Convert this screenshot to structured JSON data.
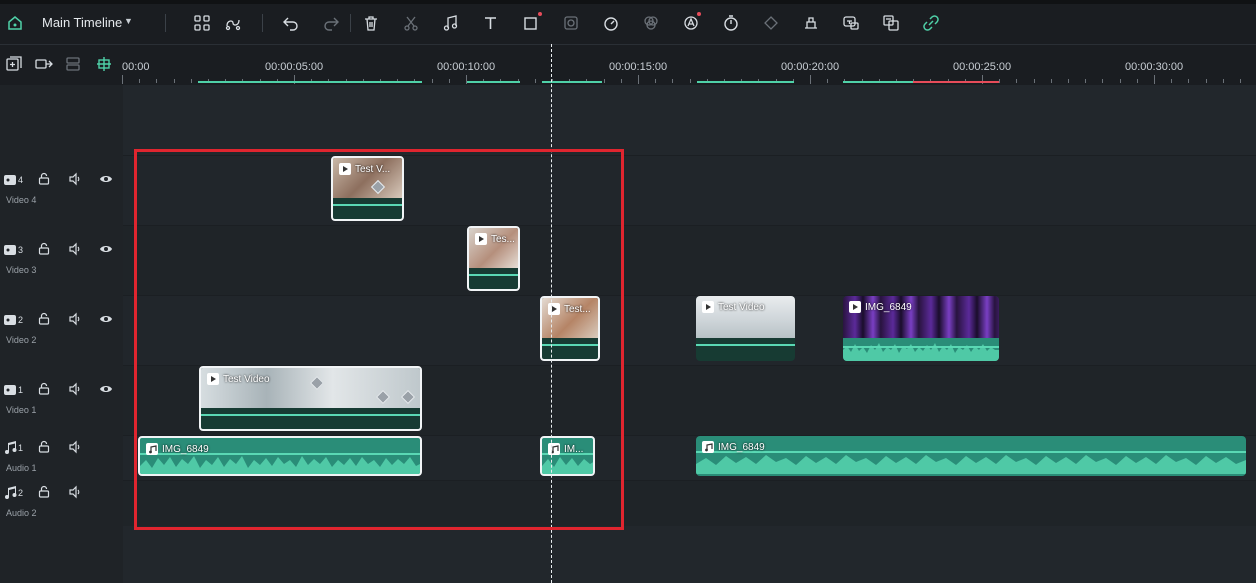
{
  "toolbar": {
    "timeline_title": "Main Timeline"
  },
  "ruler": {
    "ticks": [
      "00:00",
      "00:00:05:00",
      "00:00:10:00",
      "00:00:15:00",
      "00:00:20:00",
      "00:00:25:00",
      "00:00:30:00"
    ]
  },
  "tracks": [
    {
      "label": "Video 4",
      "num": "4"
    },
    {
      "label": "Video 3",
      "num": "3"
    },
    {
      "label": "Video 2",
      "num": "2"
    },
    {
      "label": "Video 1",
      "num": "1"
    },
    {
      "label": "Audio 1",
      "num": "1"
    },
    {
      "label": "Audio 2",
      "num": "2"
    }
  ],
  "clips": {
    "v4": "Test V...",
    "v3": "Tes...",
    "v2a": "Test...",
    "v2b": "Test Video",
    "v2c": "IMG_6849",
    "v1": "Test Video",
    "a1a": "IMG_6849",
    "a1b": "IM...",
    "a1c": "IMG_6849"
  },
  "colors": {
    "accent": "#5ad8b4",
    "selection_box": "#e0252f",
    "render_red": "#e74c5a"
  }
}
